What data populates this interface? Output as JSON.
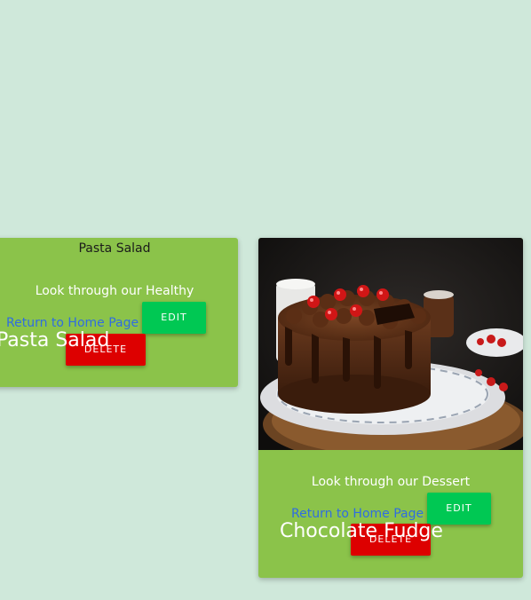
{
  "cards": [
    {
      "title": "Pasta Salad",
      "description": "Look through our Healthy",
      "return_link": "Return to Home Page",
      "edit_label": "EDIT",
      "delete_label": "DELETE",
      "name": "Pasta Salad"
    },
    {
      "image_alt": "chocolate-fudge-cake-photo",
      "description": "Look through our Dessert",
      "return_link": "Return to Home Page",
      "edit_label": "EDIT",
      "delete_label": "DELETE",
      "name": "Chocolate Fudge"
    }
  ],
  "colors": {
    "background": "#cfe8da",
    "card": "#8bc34a",
    "edit": "#00c853",
    "delete": "#dd0000",
    "link": "#2f6de0"
  }
}
